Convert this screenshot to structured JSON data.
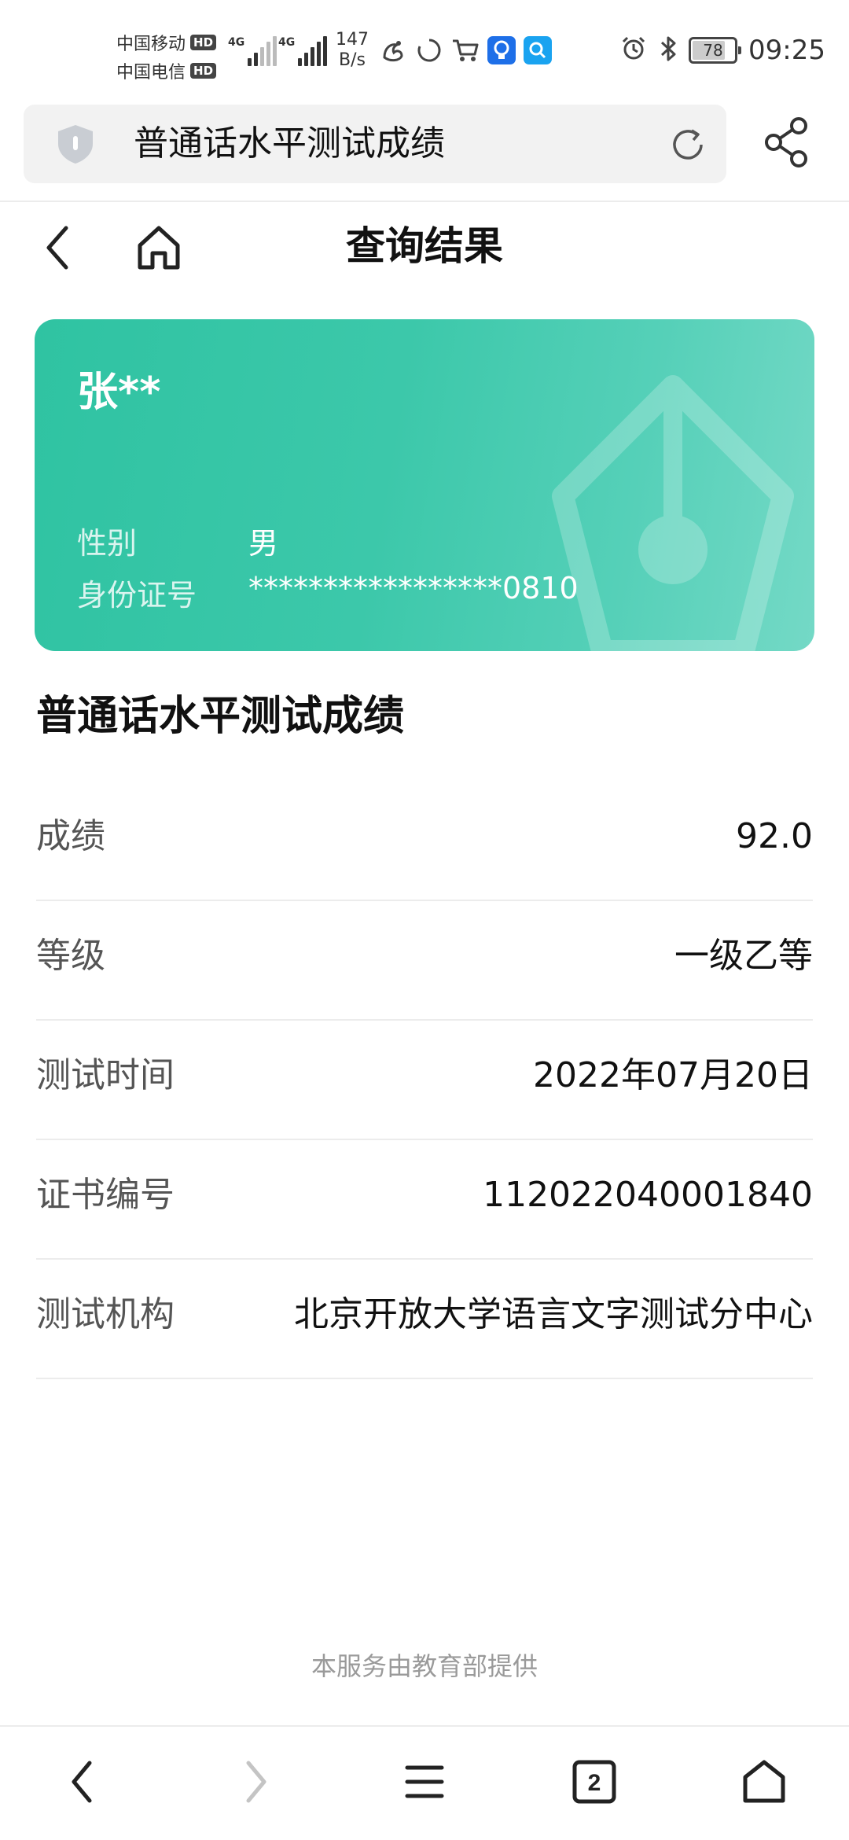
{
  "status_bar": {
    "carrier1": "中国移动",
    "carrier2": "中国电信",
    "hd_badge": "HD",
    "network1": "4G",
    "network2": "4G",
    "speed_value": "147",
    "speed_unit": "B/s",
    "battery": "78",
    "battery_level": 0.78,
    "time": "09:25",
    "icons": [
      "uc-browser-icon",
      "loading-ring-icon",
      "cart-icon",
      "lightbulb-app-icon",
      "search-app-icon",
      "alarm-icon",
      "bluetooth-icon"
    ]
  },
  "url_bar": {
    "title": "普通话水平测试成绩"
  },
  "header": {
    "title": "查询结果"
  },
  "card": {
    "name": "张**",
    "gender_label": "性别",
    "gender_value": "男",
    "id_label": "身份证号",
    "id_value": "*****************0810"
  },
  "section": {
    "title": "普通话水平测试成绩",
    "rows": [
      {
        "label": "成绩",
        "value": "92.0"
      },
      {
        "label": "等级",
        "value": "一级乙等"
      },
      {
        "label": "测试时间",
        "value": "2022年07月20日"
      },
      {
        "label": "证书编号",
        "value": "112022040001840"
      },
      {
        "label": "测试机构",
        "value": "北京开放大学语言文字测试分中心"
      }
    ]
  },
  "footer": {
    "note": "本服务由教育部提供"
  },
  "bottom_nav": {
    "tab_count": "2"
  },
  "colors": {
    "card_gradient_start": "#2fc3a2",
    "card_gradient_end": "#74d9c6",
    "app_icon_blue": "#1e6fe8",
    "app_icon_cyan": "#1aa3f0"
  }
}
